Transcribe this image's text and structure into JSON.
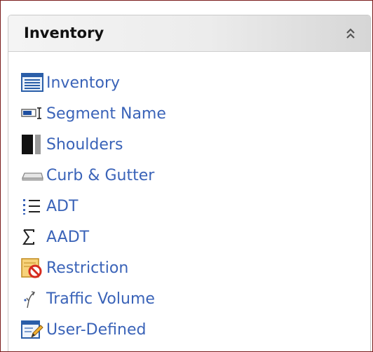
{
  "panel": {
    "title": "Inventory",
    "collapse_icon": "double-chevron-up-icon"
  },
  "menu": {
    "items": [
      {
        "label": "Inventory",
        "icon": "list-window-icon"
      },
      {
        "label": "Segment Name",
        "icon": "text-field-icon"
      },
      {
        "label": "Shoulders",
        "icon": "shoulders-icon"
      },
      {
        "label": "Curb & Gutter",
        "icon": "curb-icon"
      },
      {
        "label": "ADT",
        "icon": "numbered-list-icon"
      },
      {
        "label": "AADT",
        "icon": "sigma-icon"
      },
      {
        "label": "Restriction",
        "icon": "restriction-icon"
      },
      {
        "label": "Traffic Volume",
        "icon": "traffic-volume-icon"
      },
      {
        "label": "User-Defined",
        "icon": "edit-form-icon"
      }
    ]
  },
  "colors": {
    "link": "#3a63b8",
    "frame_border": "#7a1c1c",
    "header_bg": "#e6e6e6"
  }
}
